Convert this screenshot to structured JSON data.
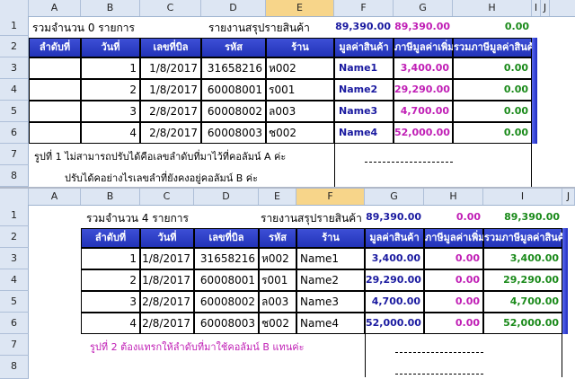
{
  "columns1": [
    "A",
    "B",
    "C",
    "D",
    "E",
    "F",
    "G",
    "H",
    "I",
    "J"
  ],
  "columns2": [
    "A",
    "B",
    "C",
    "D",
    "E",
    "F",
    "G",
    "H",
    "I",
    "J"
  ],
  "rows": [
    "1",
    "2",
    "3",
    "4",
    "5",
    "6",
    "7",
    "8"
  ],
  "sheet1": {
    "r1": {
      "a": "รวมจำนวน 0  รายการ",
      "d": "รายงานสรุปรายสินค้า",
      "f": "89,390.00",
      "g": "89,390.00",
      "h": "0.00"
    },
    "headers": [
      "ลำดับที่",
      "วันที่",
      "เลขที่บิล",
      "รหัส",
      "ร้าน",
      "มูลค่าสินค้า",
      "ภาษีมูลค่าเพิ่ม",
      "รวมภาษีมูลค่าสินค้า"
    ],
    "data": [
      {
        "no": "1",
        "date": "1/8/2017",
        "bill": "31658216",
        "code": "ห002",
        "shop": "Name1",
        "value": "3,400.00",
        "total": "0.00"
      },
      {
        "no": "2",
        "date": "1/8/2017",
        "bill": "60008001",
        "code": "ร001",
        "shop": "Name2",
        "value": "29,290.00",
        "total": "0.00"
      },
      {
        "no": "3",
        "date": "2/8/2017",
        "bill": "60008002",
        "code": "ล003",
        "shop": "Name3",
        "value": "4,700.00",
        "total": "0.00"
      },
      {
        "no": "4",
        "date": "2/8/2017",
        "bill": "60008003",
        "code": "ช002",
        "shop": "Name4",
        "value": "52,000.00",
        "total": "0.00"
      }
    ],
    "note1": "รูปที่ 1 ไม่สามารถปรับได้คือเลขลำดับที่มาไว้ที่คอลัมน์ A ค่ะ",
    "note2": "ปรับได้คอย่างไรเลขลำที่ยังคงอยู่คอลัมน์ B ค่ะ"
  },
  "sheet2": {
    "r1": {
      "b": "รวมจำนวน 4  รายการ",
      "e": "รายงานสรุปรายสินค้า",
      "g": "89,390.00",
      "h": "0.00",
      "i": "89,390.00"
    },
    "headers": [
      "ลำดับที่",
      "วันที่",
      "เลขที่บิล",
      "รหัส",
      "ร้าน",
      "มูลค่าสินค้า",
      "ภาษีมูลค่าเพิ่ม",
      "รวมภาษีมูลค่าสินค้า"
    ],
    "data": [
      {
        "no": "1",
        "date": "1/8/2017",
        "bill": "31658216",
        "code": "ห002",
        "shop": "Name1",
        "value": "3,400.00",
        "vat": "0.00",
        "total": "3,400.00"
      },
      {
        "no": "2",
        "date": "1/8/2017",
        "bill": "60008001",
        "code": "ร001",
        "shop": "Name2",
        "value": "29,290.00",
        "vat": "0.00",
        "total": "29,290.00"
      },
      {
        "no": "3",
        "date": "2/8/2017",
        "bill": "60008002",
        "code": "ล003",
        "shop": "Name3",
        "value": "4,700.00",
        "vat": "0.00",
        "total": "4,700.00"
      },
      {
        "no": "4",
        "date": "2/8/2017",
        "bill": "60008003",
        "code": "ช002",
        "shop": "Name4",
        "value": "52,000.00",
        "vat": "0.00",
        "total": "52,000.00"
      }
    ],
    "note": "รูปที่ 2 ต้องแทรกให้ลำดับที่มาใช้คอลัมน์ B แทนค่ะ"
  }
}
